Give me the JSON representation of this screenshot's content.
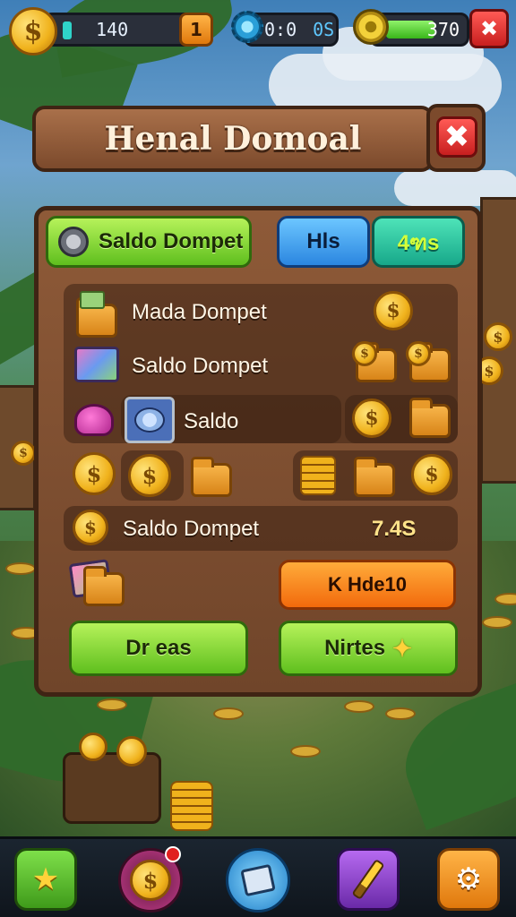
{
  "hud": {
    "coins": "140",
    "plus_left": "1",
    "timer_a": "0:0",
    "timer_b": "0S",
    "energy_value": "370",
    "energy_fill": 0.6,
    "coin_glyph": "$",
    "close_glyph": "✖"
  },
  "dialog": {
    "title": "Henal Domoal",
    "close_glyph": "✖"
  },
  "tabs": {
    "wallet_tab": "Saldo Dompet",
    "tab_2": "Hls",
    "tab_3": "4ฑs"
  },
  "rows": {
    "row1_label": "Mada Dompet",
    "row2_label": "Saldo Dompet",
    "row3_label": "Saldo",
    "total_label": "Saldo Dompet",
    "total_value": "7.4S"
  },
  "buttons": {
    "orange_label": "K Ηde10",
    "left_green": "Dr eas",
    "right_green": "Nirtes"
  },
  "icons": {
    "coin": "coin-icon",
    "folder": "folder-icon",
    "star": "star-icon",
    "brush": "brush-icon",
    "gear": "gear-icon"
  },
  "colors": {
    "panel": "#7c4a2c",
    "green_button": "#5fbf1e",
    "blue_button": "#2b86e0",
    "orange_button": "#f26a0c",
    "close_red": "#c81f1f"
  }
}
